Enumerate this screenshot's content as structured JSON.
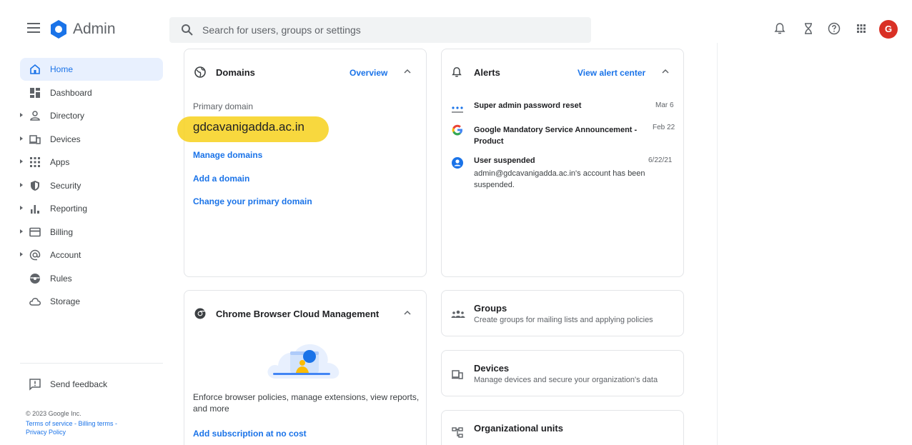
{
  "app": {
    "name": "Admin",
    "search_placeholder": "Search for users, groups or settings",
    "avatar_letter": "G",
    "icons": [
      "notifications-icon",
      "hourglass-icon",
      "help-icon",
      "apps-grid-icon"
    ]
  },
  "sidebar": {
    "items": [
      {
        "label": "Home",
        "icon": "home-icon",
        "active": true,
        "expandable": false
      },
      {
        "label": "Dashboard",
        "icon": "dashboard-icon",
        "active": false,
        "expandable": false
      },
      {
        "label": "Directory",
        "icon": "directory-icon",
        "active": false,
        "expandable": true
      },
      {
        "label": "Devices",
        "icon": "devices-icon",
        "active": false,
        "expandable": true
      },
      {
        "label": "Apps",
        "icon": "apps-icon",
        "active": false,
        "expandable": true
      },
      {
        "label": "Security",
        "icon": "security-icon",
        "active": false,
        "expandable": true
      },
      {
        "label": "Reporting",
        "icon": "reporting-icon",
        "active": false,
        "expandable": true
      },
      {
        "label": "Billing",
        "icon": "billing-icon",
        "active": false,
        "expandable": true
      },
      {
        "label": "Account",
        "icon": "account-icon",
        "active": false,
        "expandable": true
      },
      {
        "label": "Rules",
        "icon": "rules-icon",
        "active": false,
        "expandable": false
      },
      {
        "label": "Storage",
        "icon": "storage-icon",
        "active": false,
        "expandable": false
      }
    ],
    "feedback": "Send feedback",
    "copyright": "© 2023 Google Inc.",
    "terms": "Terms of service",
    "billing_terms": "Billing terms",
    "privacy": "Privacy Policy"
  },
  "domains_card": {
    "title": "Domains",
    "overview_link": "Overview",
    "primary_label": "Primary domain",
    "primary_domain": "gdcavanigadda.ac.in",
    "links": [
      "Manage domains",
      "Add a domain",
      "Change your primary domain"
    ]
  },
  "alerts_card": {
    "title": "Alerts",
    "view_link": "View alert center",
    "alerts": [
      {
        "title": "Super admin password reset",
        "date": "Mar 6",
        "desc": ""
      },
      {
        "title": "Google Mandatory Service Announcement - Product",
        "date": "Feb 22",
        "desc": ""
      },
      {
        "title": "User suspended",
        "date": "6/22/21",
        "desc": "admin@gdcavanigadda.ac.in's account has been suspended."
      }
    ]
  },
  "chrome_card": {
    "title": "Chrome Browser Cloud Management",
    "desc": "Enforce browser policies, manage extensions, view reports, and more",
    "link": "Add subscription at no cost"
  },
  "tiles": [
    {
      "title": "Groups",
      "desc": "Create groups for mailing lists and applying policies",
      "icon": "groups-icon"
    },
    {
      "title": "Devices",
      "desc": "Manage devices and secure your organization's data",
      "icon": "devices-icon"
    },
    {
      "title": "Organizational units",
      "desc": "",
      "icon": "org-units-icon"
    }
  ],
  "colors": {
    "accent": "#1a73e8",
    "highlight": "#f7d11c",
    "avatar": "#d93025",
    "active_nav": "#e8f0fe"
  }
}
